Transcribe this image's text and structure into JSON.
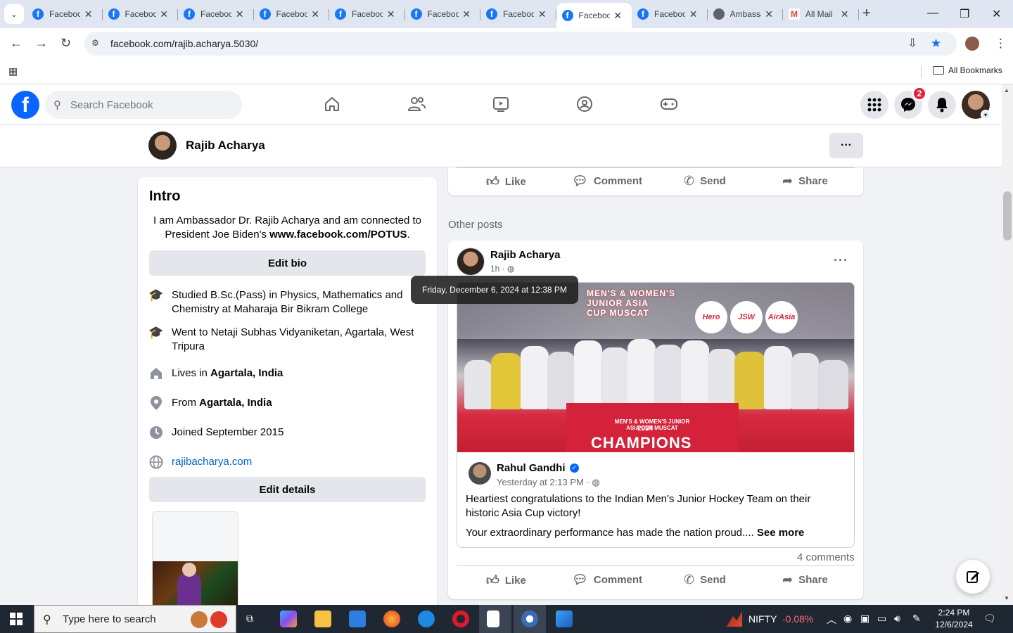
{
  "browser": {
    "tabs": [
      {
        "label": "Facebook",
        "icon": "facebook-icon"
      },
      {
        "label": "Facebook",
        "icon": "facebook-icon"
      },
      {
        "label": "Facebook",
        "icon": "facebook-icon"
      },
      {
        "label": "Facebook",
        "icon": "facebook-icon"
      },
      {
        "label": "Facebook",
        "icon": "facebook-icon"
      },
      {
        "label": "Facebook",
        "icon": "facebook-icon"
      },
      {
        "label": "Facebook",
        "icon": "facebook-icon"
      },
      {
        "label": "Facebook",
        "icon": "facebook-icon",
        "active": true
      },
      {
        "label": "Facebook",
        "icon": "facebook-icon"
      },
      {
        "label": "Ambassador",
        "icon": "globe-icon"
      },
      {
        "label": "All Mail",
        "icon": "gmail-icon"
      }
    ],
    "url": "facebook.com/rajib.acharya.5030/",
    "bookmarks_label": "All Bookmarks"
  },
  "fb": {
    "search_placeholder": "Search Facebook",
    "messenger_badge": "2",
    "profile_name": "Rajib Acharya"
  },
  "intro": {
    "title": "Intro",
    "bio_text": "I am Ambassador Dr. Rajib Acharya and am connected to President Joe Biden's ",
    "bio_link": "www.facebook.com/POTUS",
    "bio_end": ".",
    "edit_bio": "Edit bio",
    "details": [
      {
        "icon": "education-icon",
        "text": "Studied B.Sc.(Pass) in Physics, Mathematics and Chemistry at Maharaja Bir Bikram College"
      },
      {
        "icon": "education-icon",
        "text": "Went to Netaji Subhas Vidyaniketan, Agartala, West Tripura"
      },
      {
        "icon": "home-icon",
        "prefix": "Lives in ",
        "bold": "Agartala, India"
      },
      {
        "icon": "location-pin-icon",
        "prefix": "From ",
        "bold": "Agartala, India"
      },
      {
        "icon": "clock-icon",
        "text": "Joined September 2015"
      },
      {
        "icon": "globe-icon",
        "link": "rajibacharya.com"
      }
    ],
    "edit_details": "Edit details"
  },
  "actions": {
    "like": "Like",
    "comment": "Comment",
    "send": "Send",
    "share": "Share"
  },
  "other_posts_label": "Other posts",
  "post": {
    "author": "Rajib Acharya",
    "time": "1h ·",
    "tooltip": "Friday, December 6, 2024 at 12:38 PM",
    "photo": {
      "title_line1": "MEN'S & WOMEN'S",
      "title_line2": "JUNIOR ASIA",
      "title_line3": "CUP MUSCAT",
      "sponsor1": "Hero",
      "sponsor2": "JSW",
      "sponsor3": "AirAsia",
      "champ_sub": "MEN'S & WOMEN'S JUNIOR ASIA CUP MUSCAT",
      "champ_year": "2024",
      "champ_text": "CHAMPIONS"
    },
    "shared": {
      "author": "Rahul Gandhi",
      "time": "Yesterday at 2:13 PM ·",
      "text1": "Heartiest congratulations to the Indian Men's Junior Hockey Team on their historic Asia Cup victory!",
      "text2": "Your extraordinary performance has made the nation proud.... ",
      "see_more": "See more"
    },
    "comments": "4 comments"
  },
  "taskbar": {
    "search_placeholder": "Type here to search",
    "nifty_label": "NIFTY",
    "nifty_value": "-0.08%",
    "time": "2:24 PM",
    "date": "12/6/2024"
  }
}
